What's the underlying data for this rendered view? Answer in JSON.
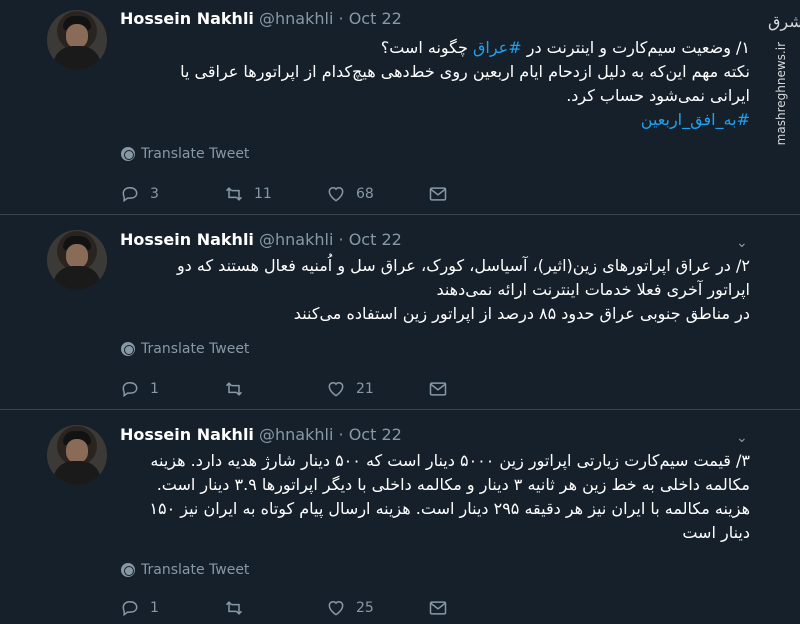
{
  "colors": {
    "background": "#15202b",
    "muted": "#8899a6",
    "link": "#1da1f2",
    "divider": "#38444d"
  },
  "watermark": {
    "logo": "مشرق",
    "site": "mashreghnews.ir"
  },
  "translate_label": "Translate Tweet",
  "tweets": [
    {
      "name": "Hossein Nakhli",
      "handle": "@hnakhli",
      "dot": "·",
      "date": "Oct 22",
      "lines": [
        "۱/ وضعیت سیم‌کارت و اینترنت در",
        "نکته مهم این‌که به دلیل ازدحام ایام اربعین روی خط‌دهی هیچ‌کدام از اپراتورها عراقی یا",
        "ایرانی نمی‌شود حساب کرد."
      ],
      "line1_hashtag": "#عراق",
      "line1_suffix": "چگونه است؟",
      "hashtag_line": "#به_افق_اربعین",
      "replies": "3",
      "retweets": "11",
      "likes": "68"
    },
    {
      "name": "Hossein Nakhli",
      "handle": "@hnakhli",
      "dot": "·",
      "date": "Oct 22",
      "lines": [
        "۲/ در عراق اپراتورهای زین(اثیر)، آسیاسل، کورک، عراق سل و اُمنیه فعال هستند که دو",
        "اپراتور آخری فعلا خدمات اینترنت ارائه نمی‌دهند",
        "در مناطق جنوبی عراق حدود ۸۵ درصد از اپراتور زین استفاده می‌کنند"
      ],
      "replies": "1",
      "retweets": "",
      "likes": "21"
    },
    {
      "name": "Hossein Nakhli",
      "handle": "@hnakhli",
      "dot": "·",
      "date": "Oct 22",
      "lines": [
        "۳/ قیمت سیم‌کارت زیارتی اپراتور زین ۵۰۰۰ دینار است که ۵۰۰ دینار شارژ هدیه دارد. هزینه",
        "مکالمه داخلی به خط زین هر ثانیه ۳ دینار و مکالمه داخلی با دیگر اپراتورها ۳.۹ دینار است.",
        "هزینه مکالمه با ایران نیز هر دقیقه ۲۹۵ دینار است. هزینه ارسال پیام کوتاه به ایران نیز ۱۵۰",
        "دینار است"
      ],
      "replies": "1",
      "retweets": "",
      "likes": "25"
    }
  ]
}
